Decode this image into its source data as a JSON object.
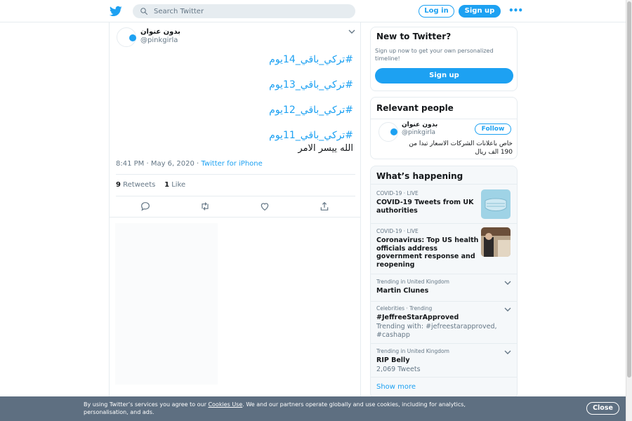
{
  "header": {
    "search_placeholder": "Search Twitter",
    "login_label": "Log in",
    "signup_label": "Sign up",
    "more_icon": "more-dots-icon"
  },
  "tweet": {
    "display_name": "بدون عنوان",
    "handle": "@pinkgirla",
    "hashtags": [
      "#تركي_باقي_14يوم",
      "#تركي_باقي_13يوم",
      "#تركي_باقي_12يوم",
      "#تركي_باقي_11يوم"
    ],
    "text": "الله ييسر الامر",
    "time": "8:41 PM · May 6, 2020 · ",
    "source": "Twitter for iPhone",
    "retweets_count": "9",
    "retweets_label": "Retweets",
    "likes_count": "1",
    "likes_label": "Like"
  },
  "sidebar": {
    "new_to_twitter": {
      "title": "New to Twitter?",
      "text": "Sign up now to get your own personalized timeline!",
      "button": "Sign up"
    },
    "relevant": {
      "title": "Relevant people",
      "name": "بدون عنوان",
      "handle": "@pinkgirla",
      "follow": "Follow",
      "bio": "خاص باعلانات الشركات الاسعار تبدا من 190 الف ريال"
    },
    "happening": {
      "title": "What’s happening",
      "trends": [
        {
          "context": "COVID-19 · LIVE",
          "title": "COVID-19 Tweets from UK authorities",
          "sub": ""
        },
        {
          "context": "COVID-19 · LIVE",
          "title": "Coronavirus: Top US health officials address government response and reopening",
          "sub": ""
        },
        {
          "context": "Trending in United Kingdom",
          "title": "Martin Clunes",
          "sub": ""
        },
        {
          "context": "Celebrities · Trending",
          "title": "#JeffreeStarApproved",
          "sub": "Trending with: #jefreestarapproved, #cashapp"
        },
        {
          "context": "Trending in United Kingdom",
          "title": "RIP Belly",
          "sub": "2,069 Tweets"
        }
      ],
      "show_more": "Show more"
    }
  },
  "cookie": {
    "text_before": "By using Twitter’s services you agree to our ",
    "link": "Cookies Use",
    "text_after": ". We and our partners operate globally and use cookies, including for analytics, personalisation, and ads.",
    "close": "Close"
  },
  "colors": {
    "accent": "#1da1f2",
    "text": "#14171a",
    "muted": "#657786",
    "border": "#e6ecf0",
    "cookie_bg": "#5e6f81"
  }
}
